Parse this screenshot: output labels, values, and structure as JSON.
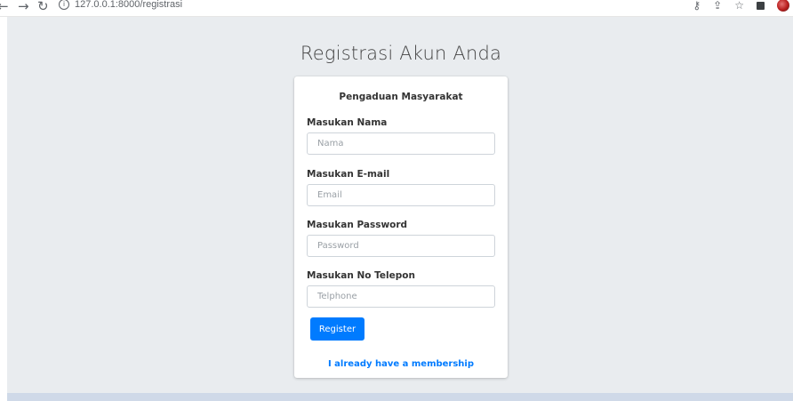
{
  "browser": {
    "back_glyph": "←",
    "forward_glyph": "→",
    "reload_glyph": "↻",
    "info_glyph": "i",
    "url": "127.0.0.1:8000/registrasi",
    "key_glyph": "⚷",
    "share_glyph": "⇪",
    "star_glyph": "☆"
  },
  "page": {
    "title": "Registrasi Akun Anda"
  },
  "card": {
    "header": "Pengaduan Masyarakat",
    "fields": [
      {
        "label": "Masukan Nama",
        "placeholder": "Nama",
        "value": ""
      },
      {
        "label": "Masukan E-mail",
        "placeholder": "Email",
        "value": ""
      },
      {
        "label": "Masukan Password",
        "placeholder": "Password",
        "value": ""
      },
      {
        "label": "Masukan No Telepon",
        "placeholder": "Telphone",
        "value": ""
      }
    ],
    "register_label": "Register",
    "membership_link": "I already have a membership"
  },
  "colors": {
    "primary": "#007bff",
    "page_background": "#e9ecef",
    "card_background": "#ffffff"
  },
  "icons": {
    "back": "arrow-left-icon",
    "forward": "arrow-right-icon",
    "reload": "reload-icon",
    "info": "info-icon",
    "key": "key-icon",
    "share": "share-icon",
    "bookmark": "star-icon",
    "extension": "extension-icon",
    "profile": "avatar"
  }
}
